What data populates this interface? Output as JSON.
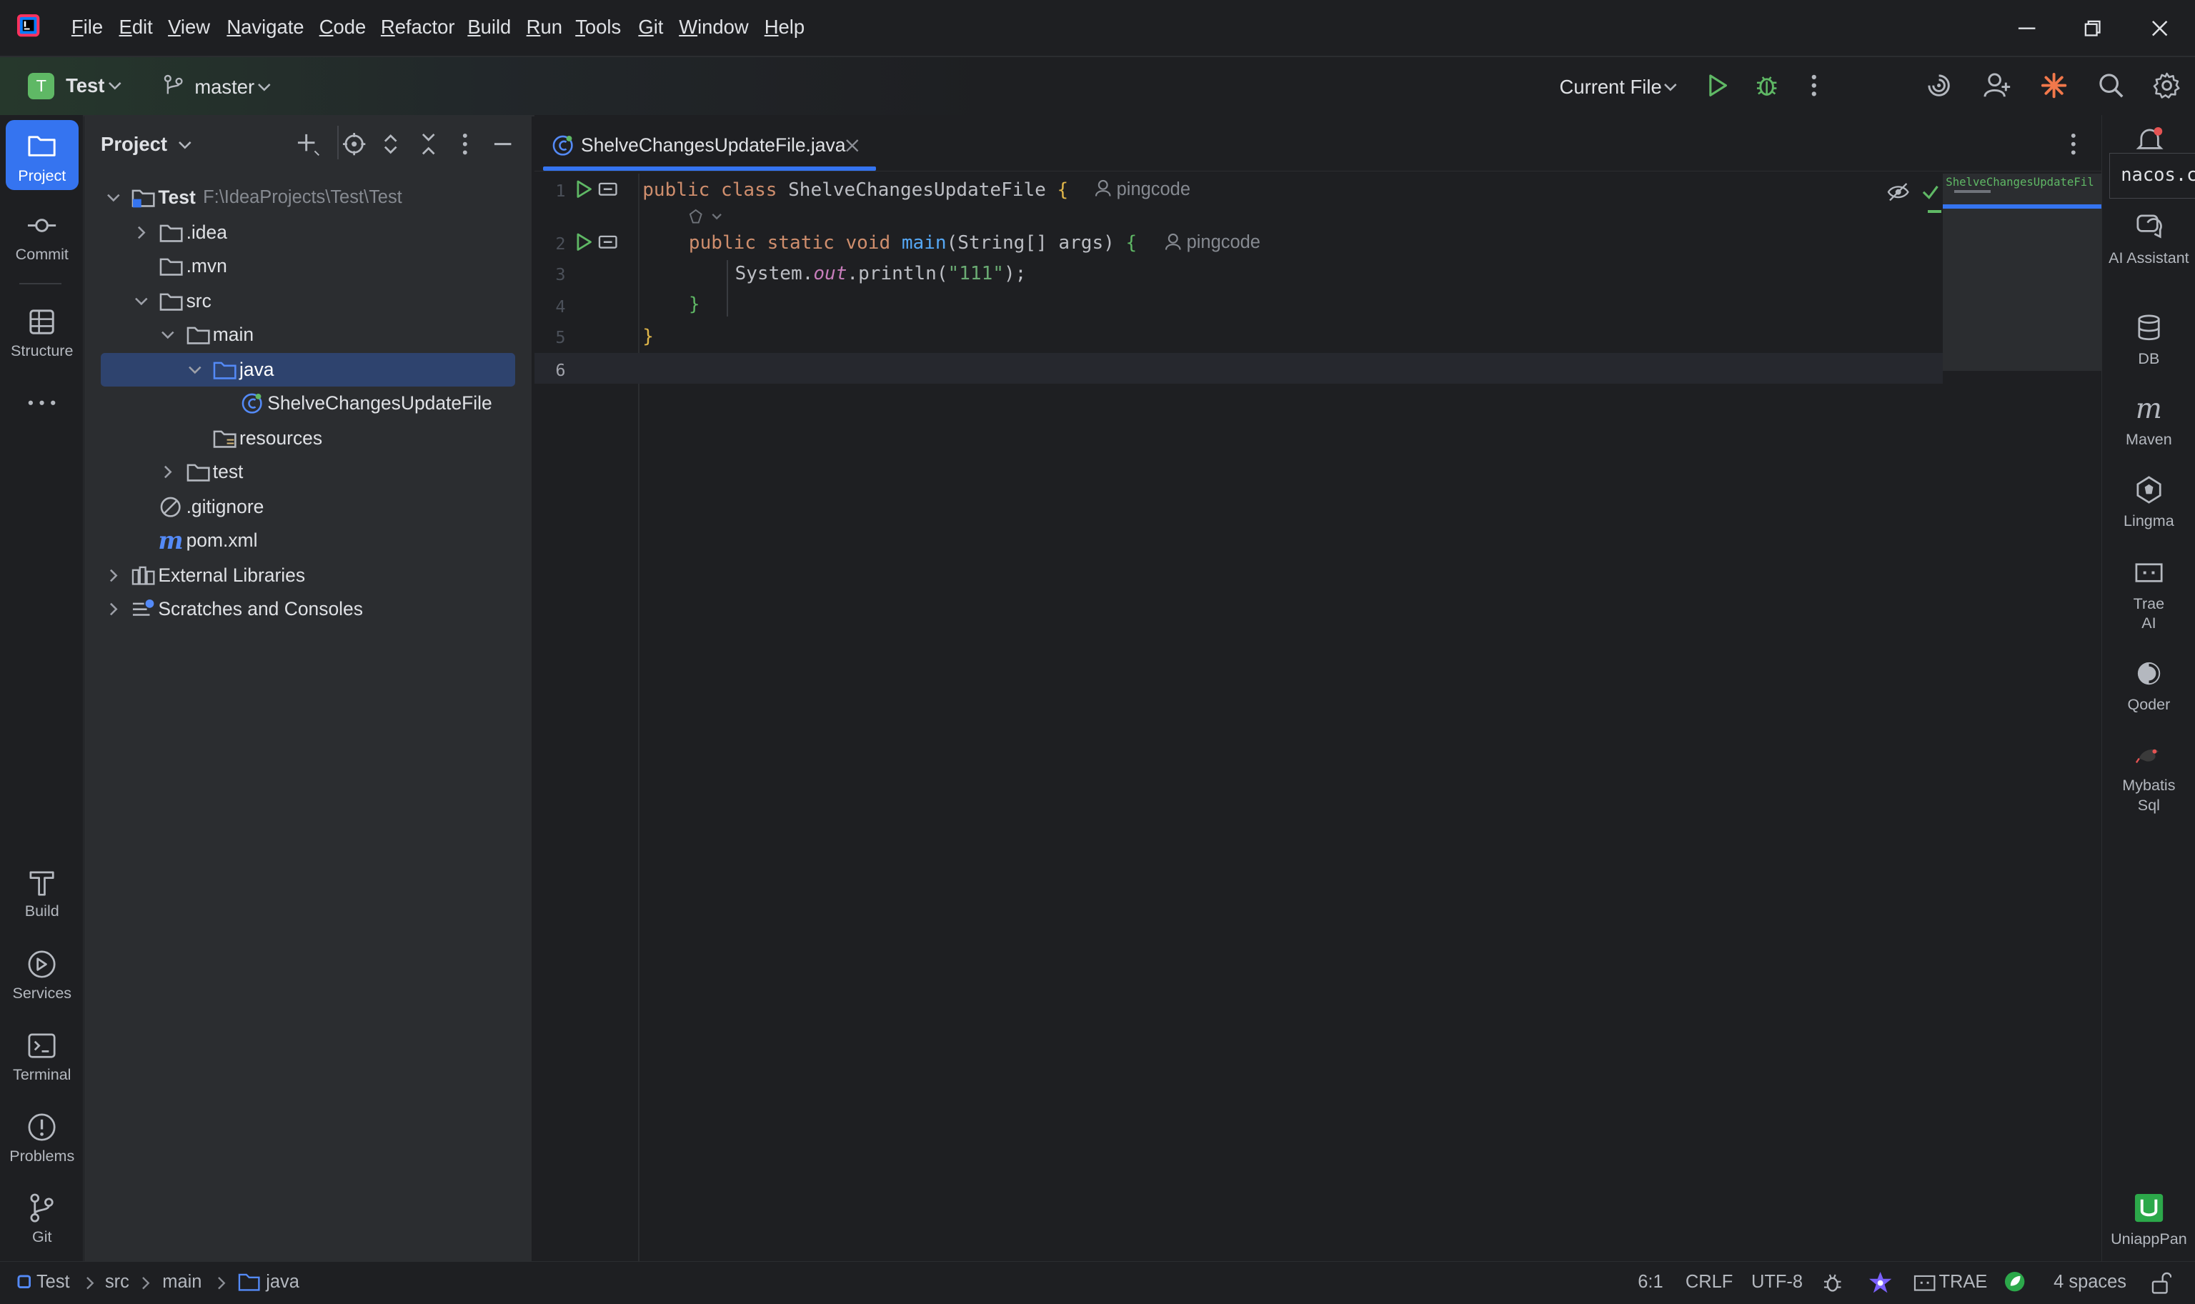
{
  "menubar": {
    "items": [
      "File",
      "Edit",
      "View",
      "Navigate",
      "Code",
      "Refactor",
      "Build",
      "Run",
      "Tools",
      "Git",
      "Window",
      "Help"
    ]
  },
  "toolbar": {
    "project_letter": "T",
    "project_name": "Test",
    "branch": "master",
    "run_config": "Current File"
  },
  "left_toolwindows": {
    "project": "Project",
    "commit": "Commit",
    "structure": "Structure",
    "build": "Build",
    "services": "Services",
    "terminal": "Terminal",
    "problems": "Problems",
    "git": "Git"
  },
  "project_panel": {
    "title": "Project",
    "tree": [
      {
        "label": "Test",
        "path": "F:\\IdeaProjects\\Test\\Test",
        "expanded": true,
        "icon": "module-folder-icon"
      },
      {
        "label": ".idea",
        "expanded": false,
        "icon": "folder-icon"
      },
      {
        "label": ".mvn",
        "icon": "folder-icon"
      },
      {
        "label": "src",
        "expanded": true,
        "icon": "folder-icon"
      },
      {
        "label": "main",
        "expanded": true,
        "icon": "folder-icon"
      },
      {
        "label": "java",
        "expanded": true,
        "selected": true,
        "icon": "source-folder-icon"
      },
      {
        "label": "ShelveChangesUpdateFile",
        "icon": "java-class-icon"
      },
      {
        "label": "resources",
        "icon": "resources-folder-icon"
      },
      {
        "label": "test",
        "expanded": false,
        "icon": "folder-icon"
      },
      {
        "label": ".gitignore",
        "icon": "ignore-file-icon"
      },
      {
        "label": "pom.xml",
        "icon": "maven-icon"
      },
      {
        "label": "External Libraries",
        "expanded": false,
        "icon": "library-icon"
      },
      {
        "label": "Scratches and Consoles",
        "expanded": false,
        "icon": "scratches-icon"
      }
    ]
  },
  "editor": {
    "tab_label": "ShelveChangesUpdateFile.java",
    "lines": [
      "1",
      "2",
      "3",
      "4",
      "5",
      "6"
    ],
    "code": {
      "l1_kw": "public class ",
      "l1_name": "ShelveChangesUpdateFile ",
      "l1_brace": "{",
      "l2_kw": "public static void ",
      "l2_fn": "main",
      "l2_rest": "(String[] args) ",
      "l2_brace": "{",
      "l3_a": "System.",
      "l3_out": "out",
      "l3_b": ".println(",
      "l3_str": "\"111\"",
      "l3_c": ");",
      "l4": "}",
      "l5": "}"
    },
    "author_hint": "pingcode",
    "minimap_label": "ShelveChangesUpdateFil"
  },
  "right_toolwindows": {
    "popup": "nacos.c",
    "ai_assistant": "AI Assistant",
    "db": "DB",
    "maven": "Maven",
    "lingma": "Lingma",
    "trae_ai": "Trae AI",
    "qoder": "Qoder",
    "mybatis": "Mybatis Sql",
    "uniapppan": "UniappPan"
  },
  "statusbar": {
    "breadcrumb": [
      "Test",
      "src",
      "main",
      "java"
    ],
    "position": "6:1",
    "line_sep": "CRLF",
    "encoding": "UTF-8",
    "trae": "TRAE",
    "indent": "4 spaces"
  },
  "colors": {
    "selection": "#2e436e",
    "accent": "#3574f0",
    "run_green": "#5fb865",
    "keyword": "#cf8e6d",
    "function": "#56a8f5",
    "string": "#6aab73"
  }
}
